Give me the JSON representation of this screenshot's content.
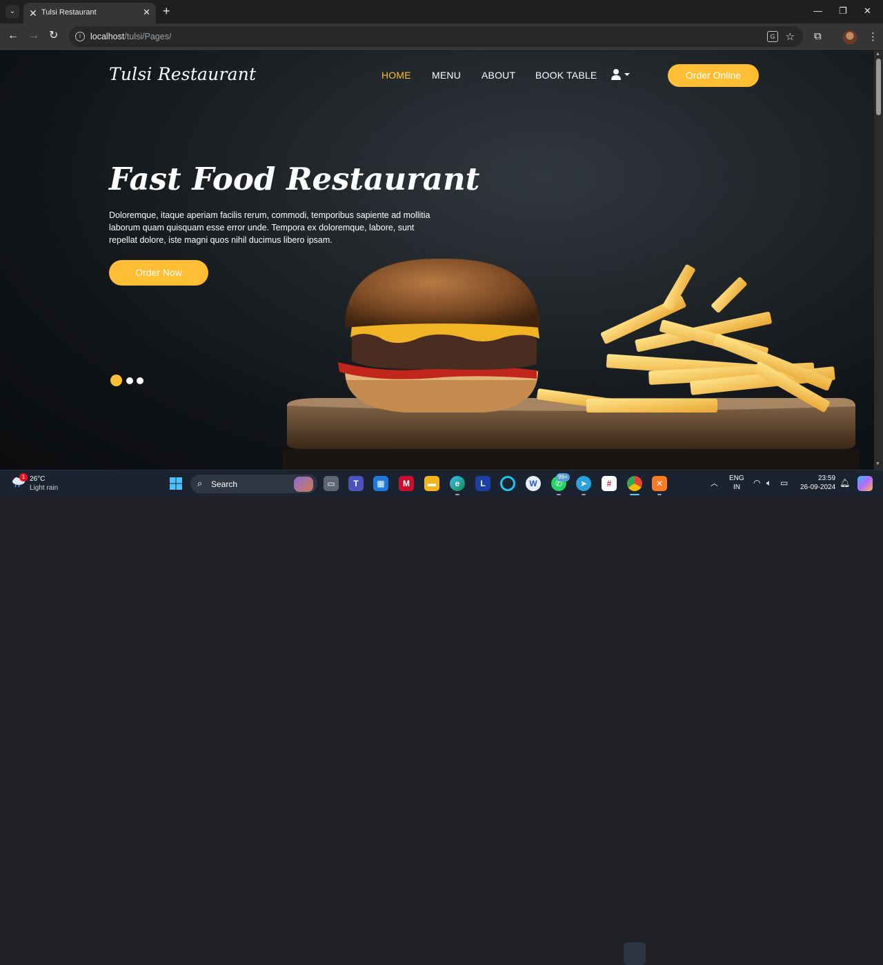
{
  "browser": {
    "tab_title": "Tulsi Restaurant",
    "url_host": "localhost",
    "url_path": "/tulsi/Pages/"
  },
  "site": {
    "brand": "Tulsi Restaurant",
    "nav": [
      {
        "label": "HOME",
        "active": true
      },
      {
        "label": "MENU",
        "active": false
      },
      {
        "label": "ABOUT",
        "active": false
      },
      {
        "label": "BOOK TABLE",
        "active": false
      }
    ],
    "order_online": "Order Online",
    "hero": {
      "title": "Fast Food Restaurant",
      "text": "Doloremque, itaque aperiam facilis rerum, commodi, temporibus sapiente ad mollitia laborum quam quisquam esse error unde. Tempora ex doloremque, labore, sunt repellat dolore, iste magni quos nihil ducimus libero ipsam.",
      "cta": "Order Now"
    },
    "carousel": {
      "slides": 3,
      "active_index": 0
    },
    "colors": {
      "accent": "#ffbe33",
      "text": "#ffffff"
    }
  },
  "taskbar": {
    "weather": {
      "temp": "26°C",
      "desc": "Light rain",
      "badge": "1"
    },
    "search_label": "Search",
    "whatsapp_badge": "99+",
    "language": {
      "line1": "ENG",
      "line2": "IN"
    },
    "clock": {
      "time": "23:59",
      "date": "26-09-2024"
    }
  }
}
